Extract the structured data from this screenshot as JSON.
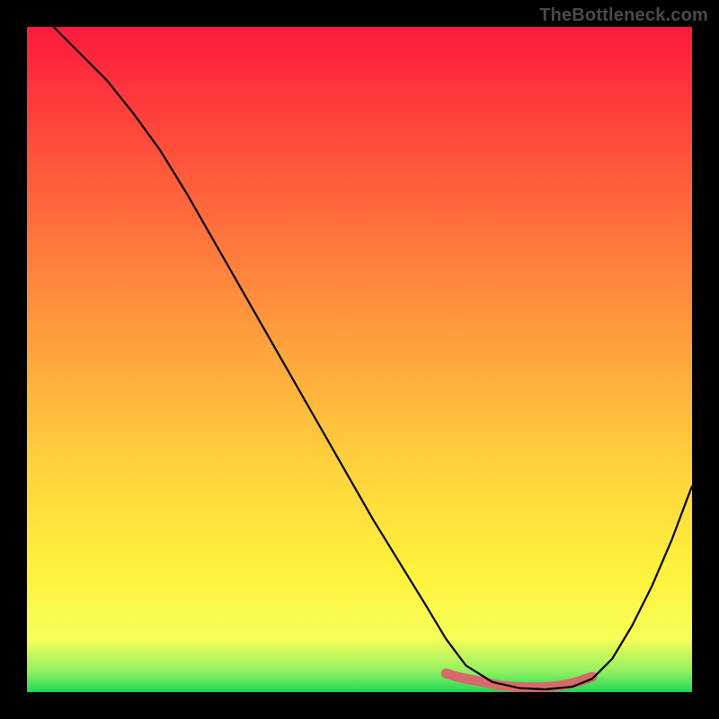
{
  "watermark": "TheBottleneck.com",
  "chart_data": {
    "type": "line",
    "title": "",
    "xlabel": "",
    "ylabel": "",
    "xlim": [
      0,
      100
    ],
    "ylim": [
      0,
      100
    ],
    "grid": false,
    "series": [
      {
        "name": "curve",
        "color": "#000000",
        "x": [
          4,
          8,
          12,
          16,
          20,
          24,
          28,
          32,
          36,
          40,
          44,
          48,
          52,
          56,
          60,
          63,
          66,
          70,
          74,
          78,
          82,
          85,
          88,
          91,
          94,
          97,
          100
        ],
        "values": [
          100,
          96,
          92,
          87,
          81.5,
          75,
          68,
          61,
          54,
          47,
          40,
          33,
          26,
          19.5,
          13,
          8,
          4,
          1.5,
          0.6,
          0.4,
          0.8,
          2,
          5,
          10,
          16,
          23,
          31
        ]
      },
      {
        "name": "marker-band",
        "color": "#d66a6a",
        "x": [
          63,
          65,
          67,
          69,
          71,
          73,
          75,
          77,
          79,
          81,
          83,
          85
        ],
        "values": [
          2.8,
          2.2,
          1.8,
          1.4,
          1.0,
          0.8,
          0.7,
          0.7,
          0.8,
          1.1,
          1.6,
          2.3
        ]
      }
    ],
    "background_gradient": {
      "stops": [
        {
          "offset": 0.0,
          "color": "#ff1a3c"
        },
        {
          "offset": 0.22,
          "color": "#ff5a3c"
        },
        {
          "offset": 0.45,
          "color": "#ff9a3c"
        },
        {
          "offset": 0.66,
          "color": "#ffd23c"
        },
        {
          "offset": 0.82,
          "color": "#fff23c"
        },
        {
          "offset": 0.92,
          "color": "#f6ff58"
        },
        {
          "offset": 0.97,
          "color": "#8ff060"
        },
        {
          "offset": 1.0,
          "color": "#1cd95a"
        }
      ]
    }
  }
}
